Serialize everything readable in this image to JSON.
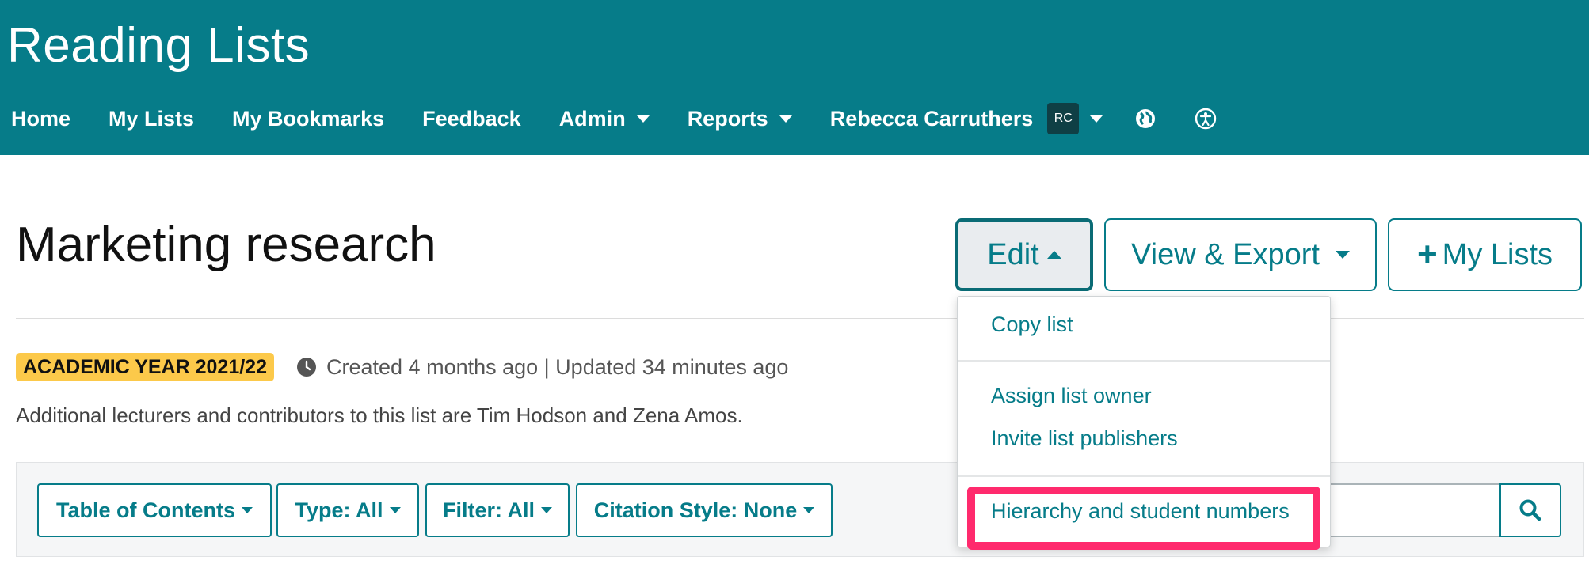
{
  "header": {
    "app_title": "Reading Lists",
    "nav": {
      "home": "Home",
      "my_lists": "My Lists",
      "my_bookmarks": "My Bookmarks",
      "feedback": "Feedback",
      "admin": "Admin",
      "reports": "Reports",
      "user_name": "Rebecca Carruthers",
      "user_initials": "RC"
    },
    "icons": [
      "chevron-down-icon",
      "globe-icon",
      "accessibility-icon"
    ]
  },
  "list": {
    "title": "Marketing research",
    "academic_year_badge": "ACADEMIC YEAR 2021/22",
    "timestamps": "Created 4 months ago | Updated 34 minutes ago",
    "contributors": "Additional lecturers and contributors to this list are Tim Hodson and Zena Amos."
  },
  "actions": {
    "edit": "Edit",
    "view_export": "View & Export",
    "add_my_lists": "My Lists"
  },
  "edit_menu": {
    "copy_list": "Copy list",
    "assign_list_owner": "Assign list owner",
    "invite_list_publishers": "Invite list publishers",
    "hierarchy_student_numbers": "Hierarchy and student numbers"
  },
  "toolbar": {
    "table_of_contents": "Table of Contents",
    "type": "Type: All",
    "filter": "Filter: All",
    "citation_style": "Citation Style: None",
    "search_value": ""
  },
  "colors": {
    "brand_teal": "#067c89",
    "badge_yellow": "#fcc94a",
    "highlight_pink": "#ff2a6d"
  }
}
